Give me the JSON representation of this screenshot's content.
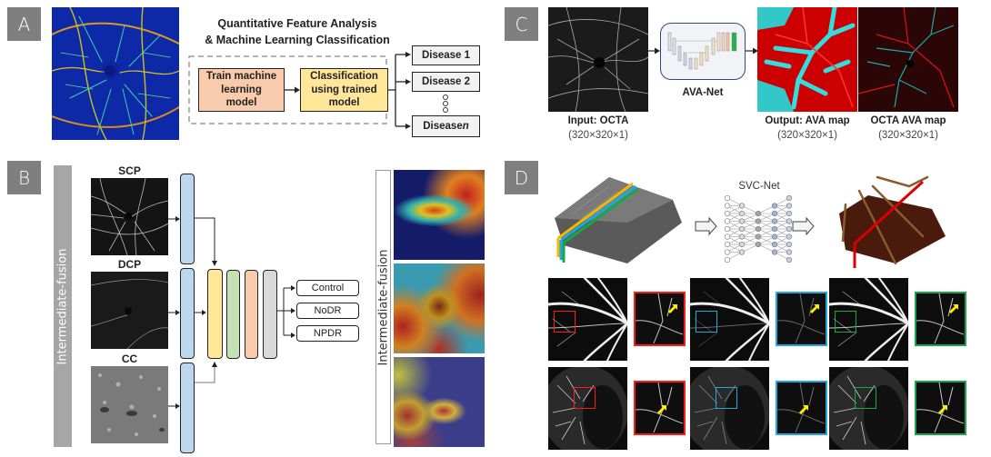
{
  "panels": {
    "A": {
      "label": "A",
      "title_line1": "Quantitative Feature Analysis",
      "title_line2": "& Machine Learning Classification",
      "train_box": "Train machine learning model",
      "classify_box": "Classification using trained model",
      "diseases": [
        "Disease 1",
        "Disease 2",
        "Disease n"
      ],
      "ellipsis": "⋮",
      "image": "color-coded OCTA vessel map"
    },
    "B": {
      "label": "B",
      "side_label": "Intermediate-fusion",
      "inputs": [
        "SCP",
        "DCP",
        "CC"
      ],
      "outputs": [
        "Control",
        "NoDR",
        "NPDR"
      ],
      "heatmap_label": "Intermediate-fusion",
      "layer_colors": {
        "encoder": "#bdd7ee",
        "fusion": "#ffe699",
        "dense1": "#c5e0b4",
        "dense2": "#f8cbad",
        "dense3": "#d9d9d9"
      }
    },
    "C": {
      "label": "C",
      "network_name": "AVA-Net",
      "input_caption": "Input: OCTA",
      "input_dims": "(320×320×1)",
      "output_caption": "Output: AVA map",
      "output_dims": "(320×320×1)",
      "overlay_caption": "OCTA AVA map",
      "overlay_dims": "(320×320×1)",
      "artery_color": "#cc0000",
      "vein_color": "#33cccc"
    },
    "D": {
      "label": "D",
      "network_name": "SVC-Net",
      "slice_colors": [
        "#f5b800",
        "#1fa8e0",
        "#14a84a"
      ],
      "highlight_colors": [
        "#ff1a1a",
        "#1fa8e0",
        "#14a84a"
      ],
      "arrow_color": "#ffee00",
      "output_line_color": "#dd0000"
    }
  }
}
